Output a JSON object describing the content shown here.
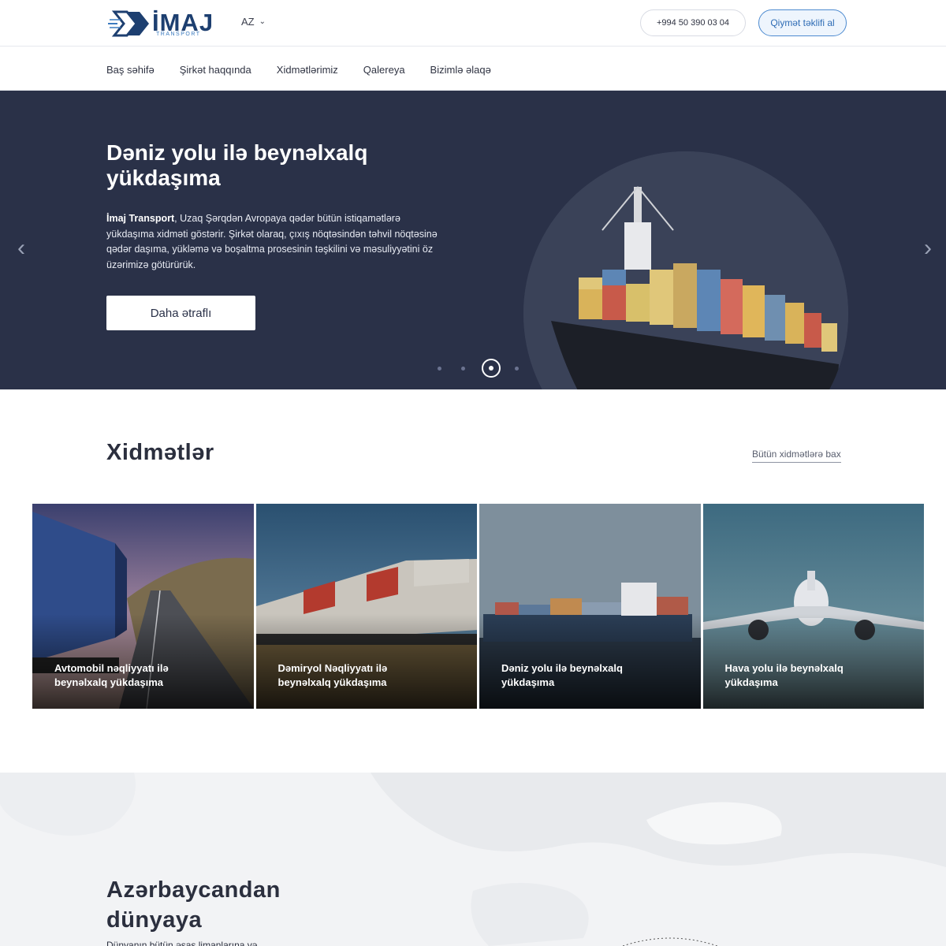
{
  "header": {
    "logo_text": "İMAJ",
    "logo_sub": "TRANSPORT",
    "lang": "AZ",
    "phone": "+994 50 390 03 04",
    "quote_label": "Qiymət təklifi al"
  },
  "nav": {
    "items": [
      {
        "label": "Baş səhifə"
      },
      {
        "label": "Şirkət haqqında"
      },
      {
        "label": "Xidmətlərimiz"
      },
      {
        "label": "Qalereya"
      },
      {
        "label": "Bizimlə əlaqə"
      }
    ]
  },
  "hero": {
    "title": "Dəniz yolu ilə beynəlxalq yükdaşıma",
    "desc_brand": "İmaj Transport",
    "desc": ", Uzaq Şərqdən Avropaya qədər bütün istiqamətlərə yükdaşıma xidməti göstərir. Şirkət olaraq, çıxış nöqtəsindən təhvil nöqtəsinə qədər daşıma, yükləmə və boşaltma prosesinin təşkilini və məsuliyyətini öz üzərimizə götürürük.",
    "button": "Daha ətraflı",
    "slides_count": 4,
    "active_slide": 3
  },
  "services": {
    "title": "Xidmətlər",
    "all_link": "Bütün xidmətlərə bax",
    "cards": [
      {
        "label": "Avtomobil nəqliyyatı ilə beynəlxalq yükdaşıma"
      },
      {
        "label": "Dəmiryol Nəqliyyatı ilə beynəlxalq yükdaşıma"
      },
      {
        "label": "Dəniz yolu ilə beynəlxalq yükdaşıma"
      },
      {
        "label": "Hava yolu ilə beynəlxalq yükdaşıma"
      }
    ]
  },
  "world": {
    "title": "Azərbaycandan dünyaya",
    "text": "Dünyanın bütün əsas limanlarına və"
  },
  "colors": {
    "hero_bg": "#2a3148",
    "accent": "#2e6cb5",
    "logo": "#1d3f70"
  }
}
